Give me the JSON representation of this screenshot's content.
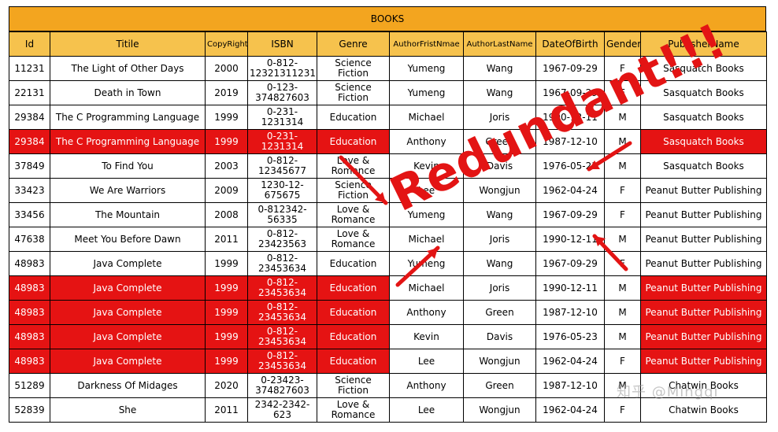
{
  "table_title": "BOOKS",
  "headers": [
    "Id",
    "Titile",
    "CopyRight",
    "ISBN",
    "Genre",
    "AuthorFristNmae",
    "AuthorLastName",
    "DateOfBirth",
    "Gender",
    "PublisherName"
  ],
  "rows": [
    {
      "highlight": false,
      "cells": [
        "11231",
        "The Light of Other Days",
        "2000",
        "0-812-12321311231",
        "Science Fiction",
        "Yumeng",
        "Wang",
        "1967-09-29",
        "F",
        "Sasquatch Books"
      ]
    },
    {
      "highlight": false,
      "cells": [
        "22131",
        "Death in Town",
        "2019",
        "0-123-374827603",
        "Science Fiction",
        "Yumeng",
        "Wang",
        "1967-09-29",
        "F",
        "Sasquatch Books"
      ]
    },
    {
      "highlight": false,
      "cells": [
        "29384",
        "The C Programming Language",
        "1999",
        "0-231-1231314",
        "Education",
        "Michael",
        "Joris",
        "1990-12-11",
        "M",
        "Sasquatch Books"
      ]
    },
    {
      "highlight": true,
      "cells": [
        "29384",
        "The C Programming Language",
        "1999",
        "0-231-1231314",
        "Education",
        "Anthony",
        "Green",
        "1987-12-10",
        "M",
        "Sasquatch Books"
      ]
    },
    {
      "highlight": false,
      "cells": [
        "37849",
        "To Find You",
        "2003",
        "0-812-12345677",
        "Love & Romance",
        "Kevin",
        "Davis",
        "1976-05-23",
        "M",
        "Sasquatch Books"
      ]
    },
    {
      "highlight": false,
      "cells": [
        "33423",
        "We Are Warriors",
        "2009",
        "1230-12-675675",
        "Science Fiction",
        "Lee",
        "Wongjun",
        "1962-04-24",
        "F",
        "Peanut Butter Publishing"
      ]
    },
    {
      "highlight": false,
      "cells": [
        "33456",
        "The Mountain",
        "2008",
        "0-812342-56335",
        "Love & Romance",
        "Yumeng",
        "Wang",
        "1967-09-29",
        "F",
        "Peanut Butter Publishing"
      ]
    },
    {
      "highlight": false,
      "cells": [
        "47638",
        "Meet You Before Dawn",
        "2011",
        "0-812-23423563",
        "Love & Romance",
        "Michael",
        "Joris",
        "1990-12-11",
        "M",
        "Peanut Butter Publishing"
      ]
    },
    {
      "highlight": false,
      "cells": [
        "48983",
        "Java Complete",
        "1999",
        "0-812-23453634",
        "Education",
        "Yumeng",
        "Wang",
        "1967-09-29",
        "F",
        "Peanut Butter Publishing"
      ]
    },
    {
      "highlight": true,
      "cells": [
        "48983",
        "Java Complete",
        "1999",
        "0-812-23453634",
        "Education",
        "Michael",
        "Joris",
        "1990-12-11",
        "M",
        "Peanut Butter Publishing"
      ]
    },
    {
      "highlight": true,
      "cells": [
        "48983",
        "Java Complete",
        "1999",
        "0-812-23453634",
        "Education",
        "Anthony",
        "Green",
        "1987-12-10",
        "M",
        "Peanut Butter Publishing"
      ]
    },
    {
      "highlight": true,
      "cells": [
        "48983",
        "Java Complete",
        "1999",
        "0-812-23453634",
        "Education",
        "Kevin",
        "Davis",
        "1976-05-23",
        "M",
        "Peanut Butter Publishing"
      ]
    },
    {
      "highlight": true,
      "cells": [
        "48983",
        "Java Complete",
        "1999",
        "0-812-23453634",
        "Education",
        "Lee",
        "Wongjun",
        "1962-04-24",
        "F",
        "Peanut Butter Publishing"
      ]
    },
    {
      "highlight": false,
      "cells": [
        "51289",
        "Darkness Of Midages",
        "2020",
        "0-23423-374827603",
        "Science Fiction",
        "Anthony",
        "Green",
        "1987-12-10",
        "M",
        "Chatwin Books"
      ]
    },
    {
      "highlight": false,
      "cells": [
        "52839",
        "She",
        "2011",
        "2342-2342-623",
        "Love & Romance",
        "Lee",
        "Wongjun",
        "1962-04-24",
        "F",
        "Chatwin Books"
      ]
    }
  ],
  "annotation": "Redundant!!!",
  "watermark": "知乎 @Mingqi",
  "colors": {
    "header": "#f6c24d",
    "title_bar": "#f3a51f",
    "highlight": "#e51313",
    "annotation": "#e31414"
  }
}
